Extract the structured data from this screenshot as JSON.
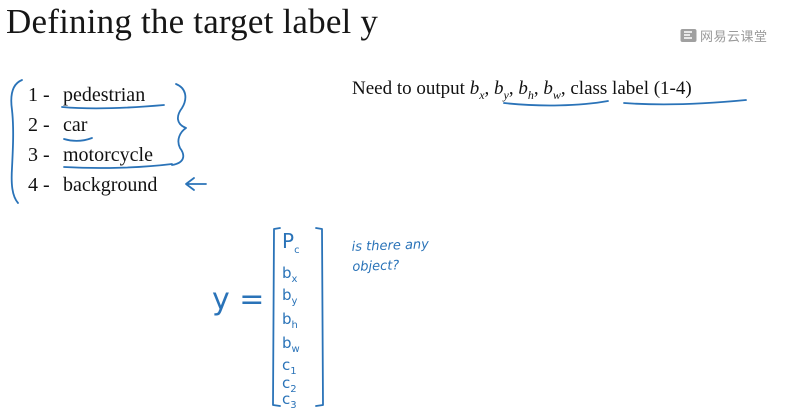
{
  "slide": {
    "title": "Defining the target label y",
    "watermark": "网易云课堂",
    "classes": [
      {
        "num": "1 -",
        "label": "pedestrian"
      },
      {
        "num": "2 -",
        "label": "car"
      },
      {
        "num": "3 -",
        "label": "motorcycle"
      },
      {
        "num": "4 -",
        "label": "background"
      }
    ],
    "output": {
      "prefix": "Need to output",
      "bx": {
        "base": "b",
        "sub": "x"
      },
      "by": {
        "base": "b",
        "sub": "y"
      },
      "bh": {
        "base": "b",
        "sub": "h"
      },
      "bw": {
        "base": "b",
        "sub": "w"
      },
      "suffix": "class label (1-4)"
    }
  },
  "handwriting": {
    "y_label": "y =",
    "vector": [
      {
        "base": "P",
        "sub": "c"
      },
      {
        "base": "b",
        "sub": "x"
      },
      {
        "base": "b",
        "sub": "y"
      },
      {
        "base": "b",
        "sub": "h"
      },
      {
        "base": "b",
        "sub": "w"
      },
      {
        "base": "c",
        "sub": "1"
      },
      {
        "base": "c",
        "sub": "2"
      },
      {
        "base": "c",
        "sub": "3"
      }
    ],
    "note": "is there any object?",
    "ink_color": "#2a73b8"
  }
}
